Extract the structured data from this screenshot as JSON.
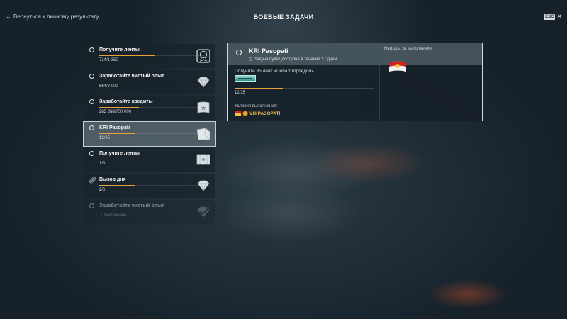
{
  "header": {
    "back_label": "Вернуться к личному результату",
    "title": "БОЕВЫЕ ЗАДАЧИ",
    "esc_label": "ESC"
  },
  "tasks": [
    {
      "title": "Получите ленты",
      "current": "714",
      "total": "/1 350",
      "progress": 0.529,
      "badge": "medal-icon"
    },
    {
      "title": "Заработайте чистый опыт",
      "current": "864",
      "total": "/2 000",
      "progress": 0.432,
      "badge": "diamond-icon"
    },
    {
      "title": "Заработайте кредиты",
      "current": "283 268",
      "total": "/750 000",
      "progress": 0.378,
      "badge": "flag-star-icon"
    },
    {
      "title": "KRI Pasopati",
      "current": "12",
      "total": "/35",
      "progress": 0.343,
      "badge": "container-icon"
    },
    {
      "title": "Получите ленты",
      "current": "1",
      "total": "/3",
      "progress": 0.333,
      "badge": "map-icon"
    },
    {
      "title": "Вызов дня",
      "current": "2",
      "total": "/6",
      "progress": 0.333,
      "badge": "diamond-icon"
    },
    {
      "title": "Заработайте чистый опыт",
      "done_label": "Выполнено",
      "badge": "check-icon"
    }
  ],
  "detail": {
    "title": "KRI Pasopati",
    "subtitle": "Задача будет доступна в течение 27 дней",
    "goal": "Получите 35 лент «Попал торпедой»",
    "progress_text": "12/35",
    "progress": 0.343,
    "conditions_label": "Условия выполнения:",
    "condition_ship": "VIII PASOPATI",
    "reward_label": "Награда за выполнение:",
    "reward_icon": "flag-reward-icon"
  },
  "colors": {
    "accent": "#e8a33a",
    "condition": "#f0b649"
  }
}
